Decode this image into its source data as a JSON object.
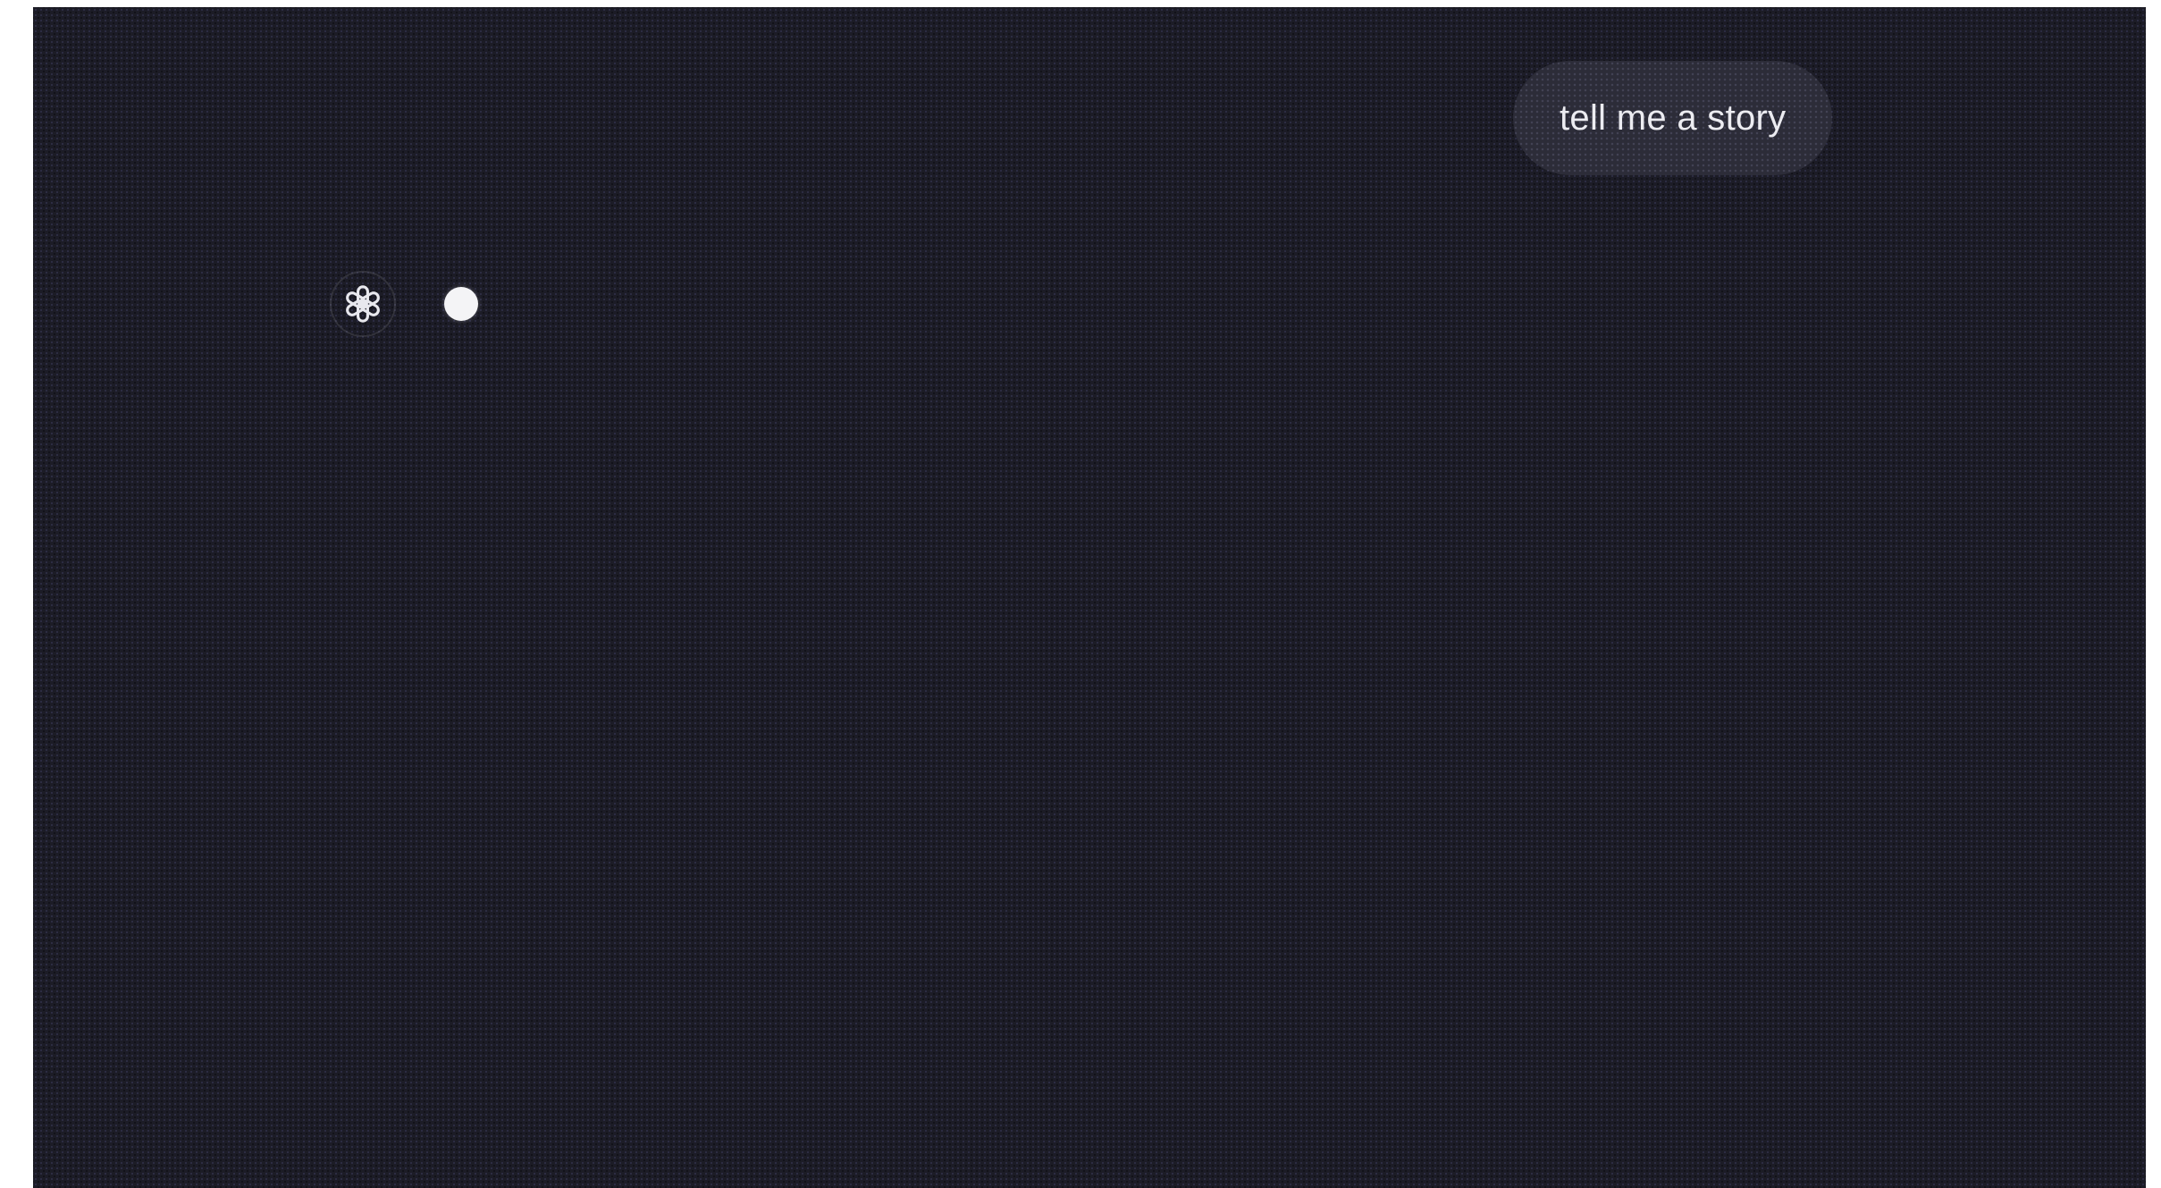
{
  "conversation": {
    "user_message": "tell me a story",
    "assistant": {
      "avatar_icon": "openai-logo-icon",
      "status_icon": "typing-indicator-dot"
    }
  },
  "colors": {
    "background": "#1c1c26",
    "user_bubble": "#2c2c38",
    "text": "#ececf1",
    "indicator": "#f4f4f6"
  }
}
